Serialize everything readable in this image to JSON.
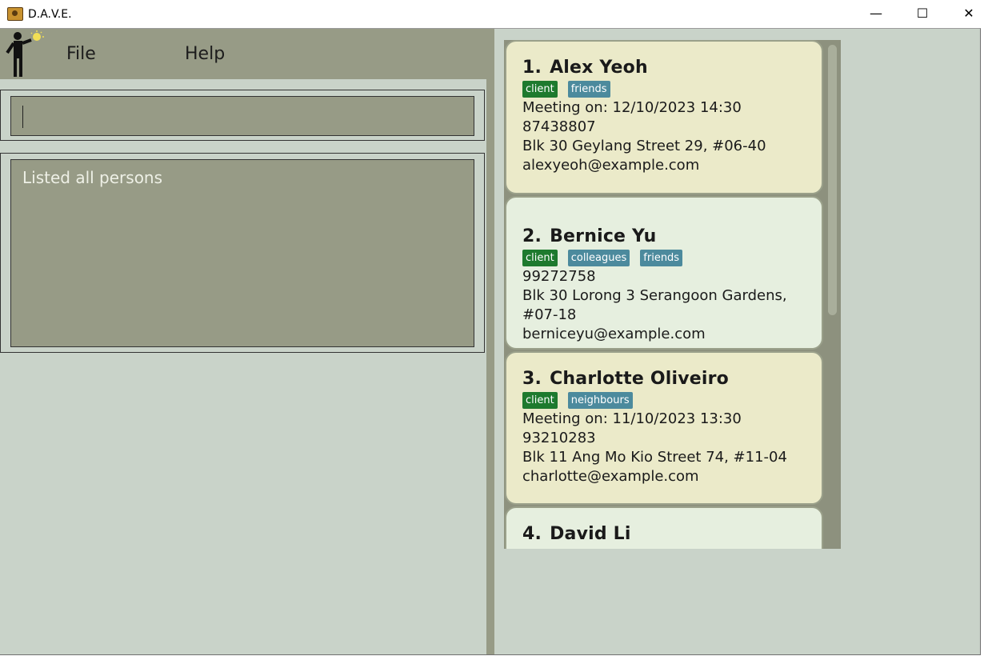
{
  "window": {
    "title": "D.A.V.E.",
    "minimize": "—",
    "maximize": "☐",
    "close": "✕"
  },
  "menu": {
    "file": "File",
    "help": "Help"
  },
  "command": {
    "value": ""
  },
  "result": {
    "message": "Listed all persons"
  },
  "persons": [
    {
      "index": "1.",
      "name": "Alex Yeoh",
      "tags": [
        "client",
        "friends"
      ],
      "meeting": "Meeting on: 12/10/2023 14:30",
      "phone": "87438807",
      "address": "Blk 30 Geylang Street 29, #06-40",
      "email": "alexyeoh@example.com"
    },
    {
      "index": "2.",
      "name": "Bernice Yu",
      "tags": [
        "client",
        "colleagues",
        "friends"
      ],
      "meeting": "",
      "phone": "99272758",
      "address": "Blk 30 Lorong 3 Serangoon Gardens, #07-18",
      "email": "berniceyu@example.com"
    },
    {
      "index": "3.",
      "name": "Charlotte Oliveiro",
      "tags": [
        "client",
        "neighbours"
      ],
      "meeting": "Meeting on: 11/10/2023 13:30",
      "phone": "93210283",
      "address": "Blk 11 Ang Mo Kio Street 74, #11-04",
      "email": "charlotte@example.com"
    },
    {
      "index": "4.",
      "name": "David Li",
      "tags": [],
      "meeting": "",
      "phone": "",
      "address": "",
      "email": ""
    }
  ],
  "colors": {
    "client_tag": "#1e7a2e",
    "other_tag": "#4c8a9d",
    "card_odd": "#ebeac9",
    "card_even": "#e6efdf",
    "menubar": "#979b86"
  }
}
